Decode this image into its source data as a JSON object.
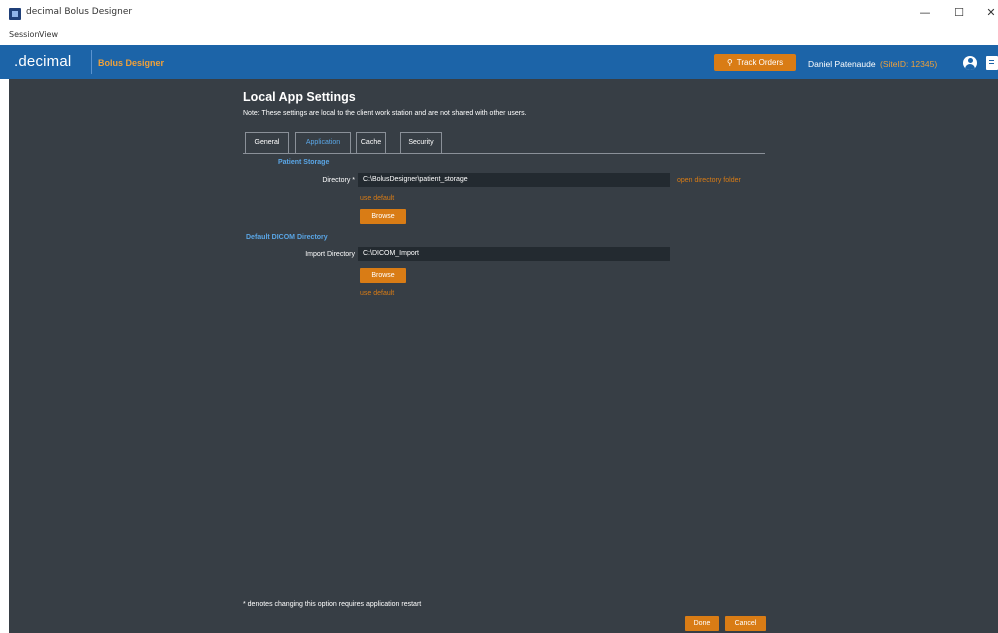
{
  "window": {
    "title": "decimal Bolus Designer",
    "minimize": "—",
    "maximize": "☐",
    "close": "✕"
  },
  "menu": {
    "session": "Session",
    "view": "View"
  },
  "header": {
    "brand": ".decimal",
    "product": "Bolus Designer",
    "track_orders": "Track Orders",
    "user_name": "Daniel Patenaude",
    "site_id": "(SiteID: 12345)",
    "colors": {
      "header_bg": "#1c64a8",
      "accent": "#d97c15"
    }
  },
  "page": {
    "title": "Local App Settings",
    "note": "Note: These settings are local to the client work station and are not shared with other users.",
    "tabs": [
      {
        "label": "General",
        "active": false
      },
      {
        "label": "Application",
        "active": true
      },
      {
        "label": "Cache",
        "active": false
      },
      {
        "label": "Security",
        "active": false
      }
    ],
    "patient_storage": {
      "section_label": "Patient Storage",
      "directory_label": "Directory *",
      "directory_value": "C:\\BolusDesigner\\patient_storage",
      "open_folder": "open directory folder",
      "use_default": "use default",
      "browse": "Browse"
    },
    "dicom": {
      "section_label": "Default DICOM Directory",
      "import_label": "Import Directory",
      "import_value": "C:\\DICOM_Import",
      "browse": "Browse",
      "use_default": "use default"
    },
    "footnote": "* denotes changing this option requires application restart",
    "done": "Done",
    "cancel": "Cancel"
  }
}
